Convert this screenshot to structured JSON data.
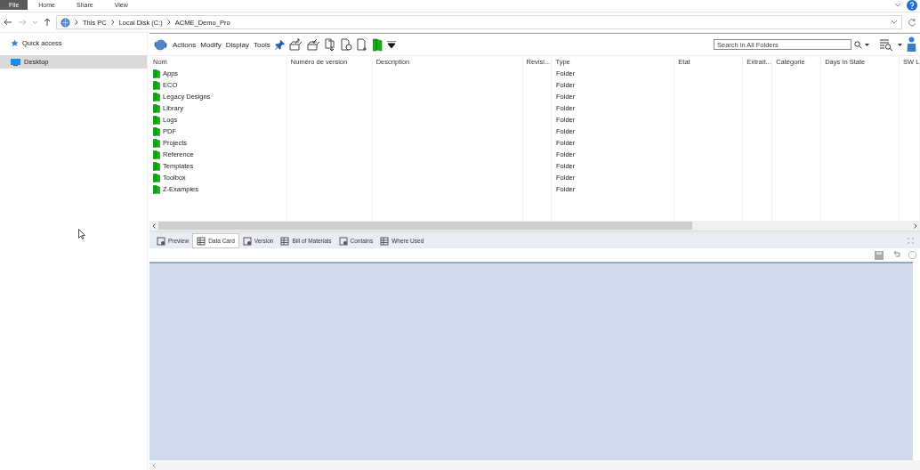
{
  "ribbon_tabs": [
    {
      "label": "File",
      "selected": true
    },
    {
      "label": "Home",
      "selected": false
    },
    {
      "label": "Share",
      "selected": false
    },
    {
      "label": "View",
      "selected": false
    }
  ],
  "address_bar": {
    "breadcrumbs": [
      "This PC",
      "Local Disk (C:)",
      "ACME_Demo_Pro"
    ]
  },
  "sidebar": {
    "items": [
      {
        "label": "Quick access",
        "kind": "star",
        "selected": false
      },
      {
        "label": "Desktop",
        "kind": "monitor",
        "selected": true
      }
    ]
  },
  "toolbar": {
    "menus": [
      "Actions",
      "Modify",
      "Display",
      "Tools"
    ],
    "search": {
      "placeholder": "Search in All Folders"
    }
  },
  "table": {
    "columns": [
      "Nom",
      "Numéro de version",
      "Description",
      "Revisi...",
      "Type",
      "Etat",
      "Extrait...",
      "Catégorie",
      "Days In State",
      "SW L"
    ],
    "rows": [
      {
        "name": "Apps",
        "type": "Folder"
      },
      {
        "name": "ECO",
        "type": "Folder"
      },
      {
        "name": "Legacy Designs",
        "type": "Folder"
      },
      {
        "name": "Library",
        "type": "Folder"
      },
      {
        "name": "Logs",
        "type": "Folder"
      },
      {
        "name": "PDF",
        "type": "Folder"
      },
      {
        "name": "Projects",
        "type": "Folder"
      },
      {
        "name": "Reference",
        "type": "Folder"
      },
      {
        "name": "Templates",
        "type": "Folder"
      },
      {
        "name": "Toolbox",
        "type": "Folder"
      },
      {
        "name": "Z-Examples",
        "type": "Folder"
      }
    ]
  },
  "bottom_tabs": [
    {
      "label": "Preview",
      "selected": false
    },
    {
      "label": "Data Card",
      "selected": true
    },
    {
      "label": "Version",
      "selected": false
    },
    {
      "label": "Bill of Materials",
      "selected": false
    },
    {
      "label": "Contains",
      "selected": false
    },
    {
      "label": "Where Used",
      "selected": false
    }
  ]
}
